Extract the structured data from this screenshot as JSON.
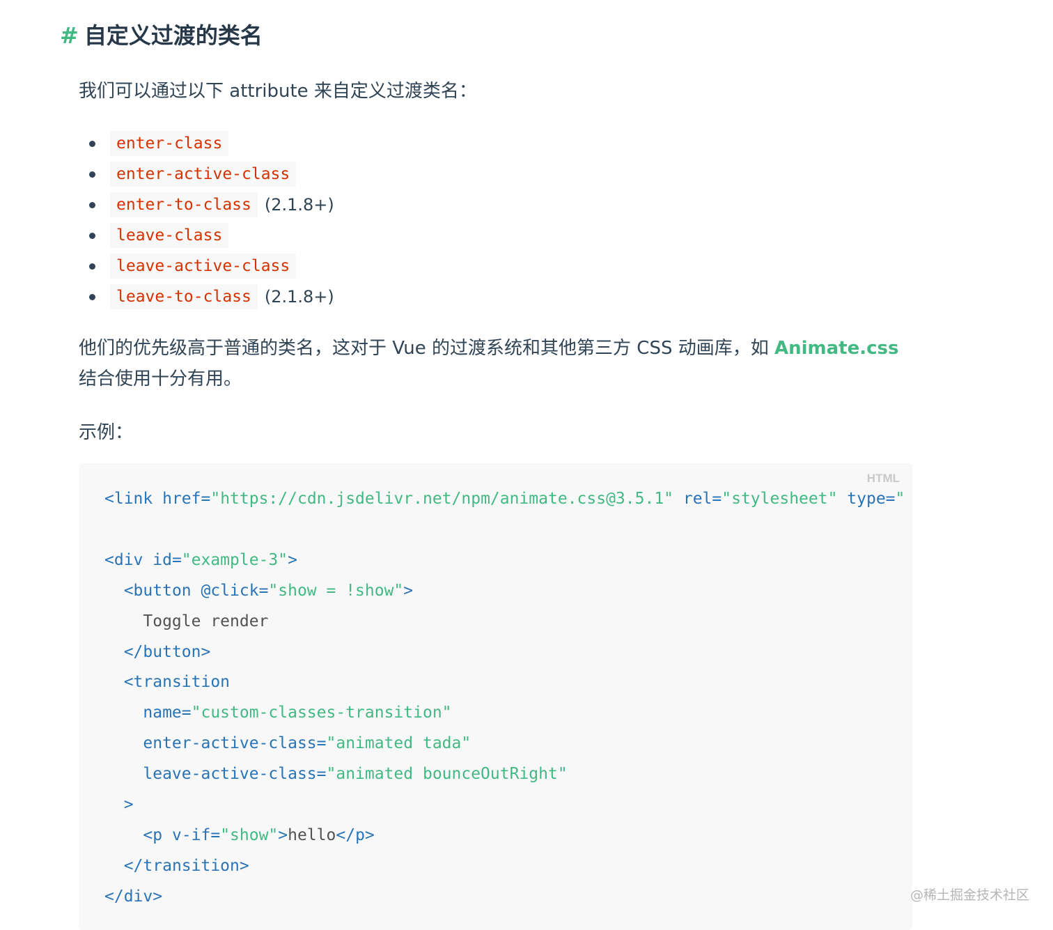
{
  "heading": {
    "hash": "#",
    "title": "自定义过渡的类名"
  },
  "intro": "我们可以通过以下 attribute 来自定义过渡类名：",
  "class_list": [
    {
      "code": "enter-class",
      "note": ""
    },
    {
      "code": "enter-active-class",
      "note": ""
    },
    {
      "code": "enter-to-class",
      "note": "(2.1.8+)"
    },
    {
      "code": "leave-class",
      "note": ""
    },
    {
      "code": "leave-active-class",
      "note": ""
    },
    {
      "code": "leave-to-class",
      "note": "(2.1.8+)"
    }
  ],
  "paragraph": {
    "before_link": "他们的优先级高于普通的类名，这对于 Vue 的过渡系统和其他第三方 CSS 动画库，如 ",
    "link": "Animate.css",
    "after_link": "结合使用十分有用。"
  },
  "example_label": "示例：",
  "code_block": {
    "lang": "HTML",
    "lines": [
      [
        [
          "tag",
          "<link "
        ],
        [
          "attr",
          "href="
        ],
        [
          "str",
          "\"https://cdn.jsdelivr.net/npm/animate.css@3.5.1\""
        ],
        [
          "attr",
          " rel="
        ],
        [
          "str",
          "\"stylesheet\""
        ],
        [
          "attr",
          " type="
        ],
        [
          "str",
          "\""
        ]
      ],
      [],
      [
        [
          "tag",
          "<div "
        ],
        [
          "attr",
          "id="
        ],
        [
          "str",
          "\"example-3\""
        ],
        [
          "tag",
          ">"
        ]
      ],
      [
        [
          "txt",
          "  "
        ],
        [
          "tag",
          "<button "
        ],
        [
          "attr",
          "@click="
        ],
        [
          "str",
          "\"show = !show\""
        ],
        [
          "tag",
          ">"
        ]
      ],
      [
        [
          "txt",
          "    Toggle render"
        ]
      ],
      [
        [
          "txt",
          "  "
        ],
        [
          "tag",
          "</button>"
        ]
      ],
      [
        [
          "txt",
          "  "
        ],
        [
          "tag",
          "<transition"
        ]
      ],
      [
        [
          "txt",
          "    "
        ],
        [
          "attr",
          "name="
        ],
        [
          "str",
          "\"custom-classes-transition\""
        ]
      ],
      [
        [
          "txt",
          "    "
        ],
        [
          "attr",
          "enter-active-class="
        ],
        [
          "str",
          "\"animated tada\""
        ]
      ],
      [
        [
          "txt",
          "    "
        ],
        [
          "attr",
          "leave-active-class="
        ],
        [
          "str",
          "\"animated bounceOutRight\""
        ]
      ],
      [
        [
          "txt",
          "  "
        ],
        [
          "tag",
          ">"
        ]
      ],
      [
        [
          "txt",
          "    "
        ],
        [
          "tag",
          "<p "
        ],
        [
          "attr",
          "v-if="
        ],
        [
          "str",
          "\"show\""
        ],
        [
          "tag",
          ">"
        ],
        [
          "txt",
          "hello"
        ],
        [
          "tag",
          "</p>"
        ]
      ],
      [
        [
          "txt",
          "  "
        ],
        [
          "tag",
          "</transition>"
        ]
      ],
      [
        [
          "tag",
          "</div>"
        ]
      ]
    ]
  },
  "watermark": "@稀土掘金技术社区",
  "colors": {
    "accent": "#42b983",
    "code_bg": "#f8f8f8",
    "inline_code": "#d63200",
    "tag": "#2973b7"
  }
}
